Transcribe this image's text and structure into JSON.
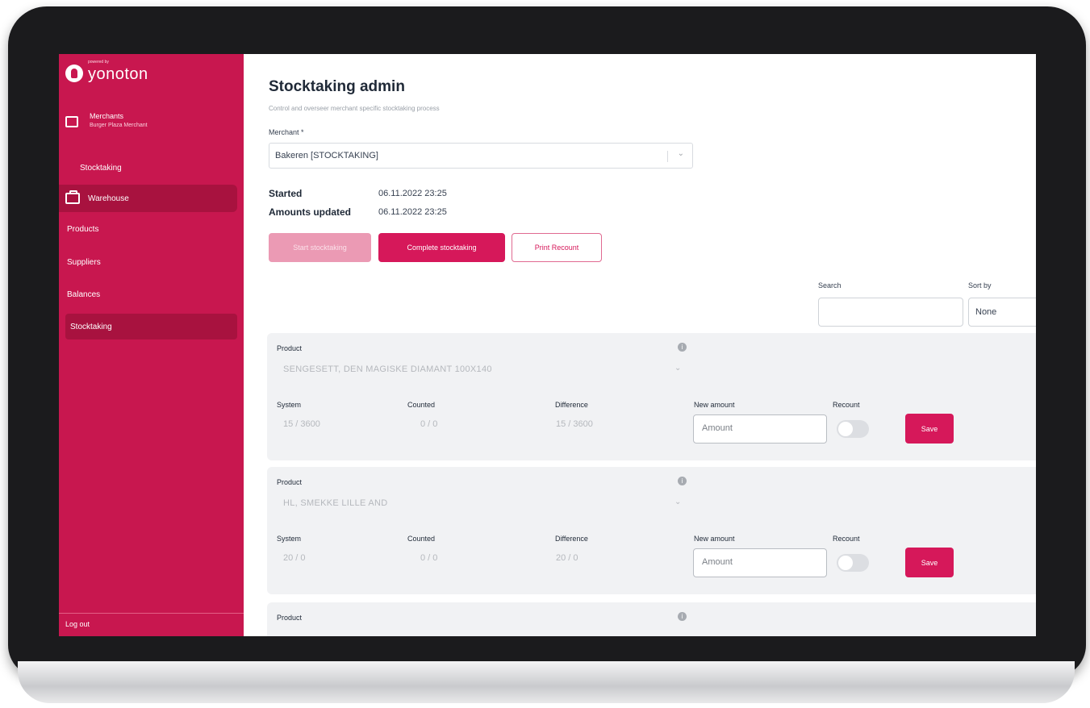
{
  "brand": {
    "powered_by": "powered by",
    "name": "yonoton"
  },
  "sidebar": {
    "merchants_title": "Merchants",
    "merchant_name": "Burger Plaza Merchant",
    "stocktaking_link": "Stocktaking",
    "warehouse": "Warehouse",
    "products": "Products",
    "suppliers": "Suppliers",
    "balances": "Balances",
    "stocktaking_active": "Stocktaking",
    "logout": "Log out"
  },
  "page": {
    "title": "Stocktaking admin",
    "subtitle": "Control and overseer merchant specific stocktaking process",
    "merchant_label": "Merchant *",
    "merchant_value": "Bakeren [STOCKTAKING]",
    "started_label": "Started",
    "started_value": "06.11.2022 23:25",
    "updated_label": "Amounts updated",
    "updated_value": "06.11.2022 23:25",
    "buttons": {
      "start": "Start stocktaking",
      "complete": "Complete stocktaking",
      "print": "Print Recount"
    },
    "search_label": "Search",
    "sort_label": "Sort by",
    "sort_value": "None"
  },
  "columns": {
    "product": "Product",
    "system": "System",
    "counted": "Counted",
    "difference": "Difference",
    "new_amount": "New amount",
    "recount": "Recount",
    "amount_placeholder": "Amount",
    "save": "Save"
  },
  "rows": [
    {
      "product": "SENGESETT, DEN MAGISKE DIAMANT 100X140",
      "system": "15 / 3600",
      "counted": "0 / 0",
      "difference": "15 / 3600"
    },
    {
      "product": "HL, SMEKKE LILLE AND",
      "system": "20 / 0",
      "counted": "0 / 0",
      "difference": "20 / 0"
    },
    {
      "product": ""
    }
  ],
  "colors": {
    "accent": "#d6185a",
    "sidebar": "#c8174f"
  }
}
